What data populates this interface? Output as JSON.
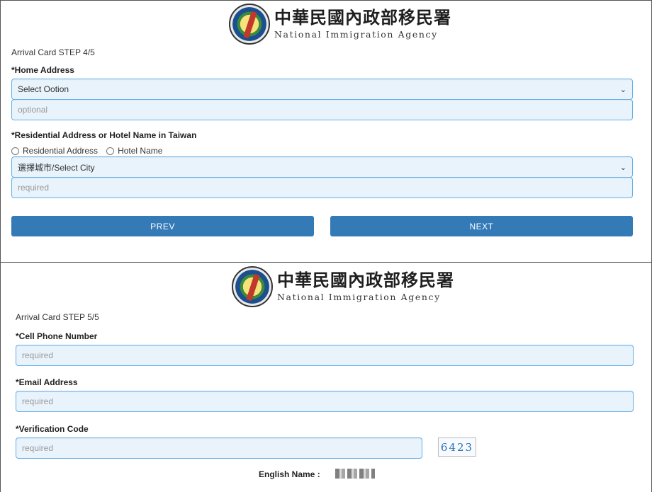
{
  "agency": {
    "name_zh": "中華民國內政部移民署",
    "name_en": "National Immigration Agency"
  },
  "step4": {
    "step_label": "Arrival Card STEP 4/5",
    "home_address_label": "*Home Address",
    "home_country_select": "Select Ootion",
    "home_address_placeholder": "optional",
    "residential_label": "*Residential Address or Hotel Name in Taiwan",
    "radio_options": [
      "Residential Address",
      "Hotel Name"
    ],
    "city_select": "選擇城市/Select City",
    "residential_placeholder": "required",
    "prev_button": "PREV",
    "next_button": "NEXT"
  },
  "step5": {
    "step_label": "Arrival Card STEP 5/5",
    "phone_label": "*Cell Phone Number",
    "phone_placeholder": "required",
    "email_label": "*Email Address",
    "email_placeholder": "required",
    "verification_label": "*Verification Code",
    "verification_placeholder": "required",
    "captcha_text": "6423",
    "english_name_label": "English Name :"
  },
  "colors": {
    "primary_button": "#337ab7",
    "field_border": "#66afe9",
    "field_background": "#e8f3fc"
  }
}
